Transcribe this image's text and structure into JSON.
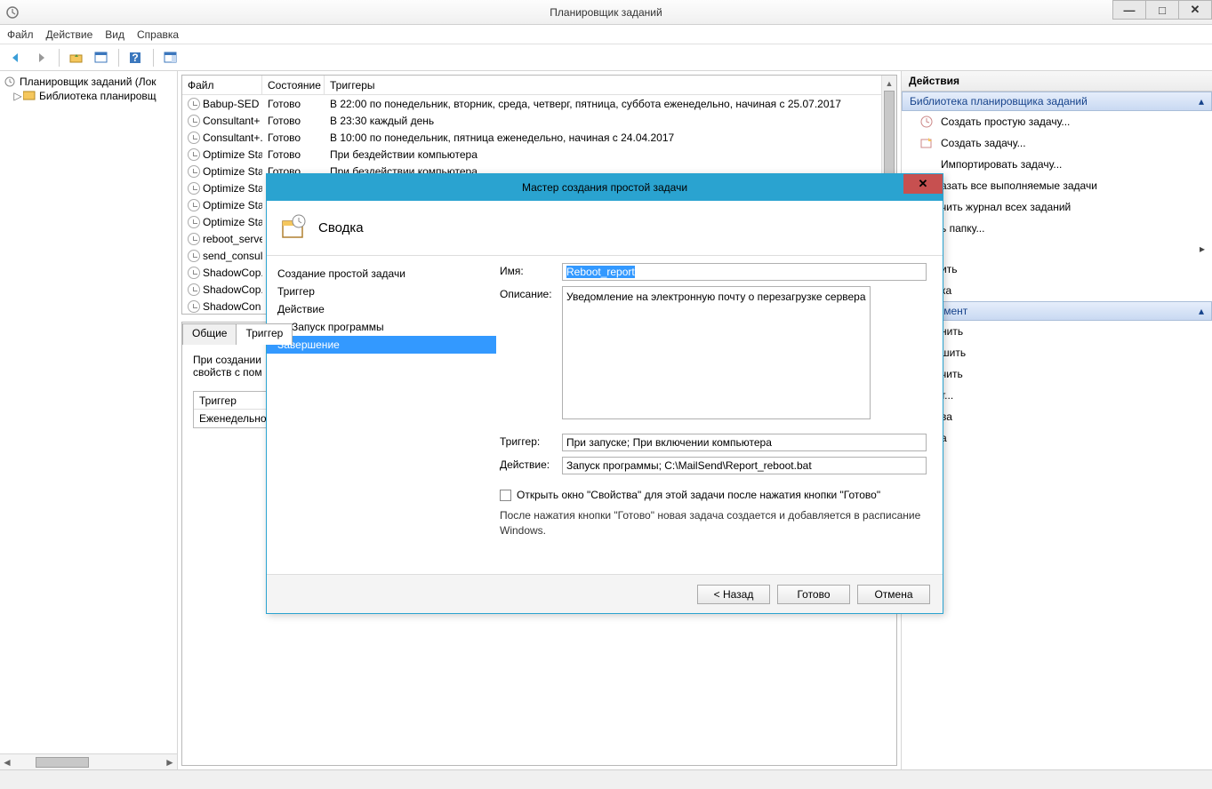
{
  "window": {
    "title": "Планировщик заданий",
    "min": "—",
    "max": "□",
    "close": "✕"
  },
  "menus": {
    "file": "Файл",
    "action": "Действие",
    "view": "Вид",
    "help": "Справка"
  },
  "tree": {
    "root": "Планировщик заданий (Лок",
    "library": "Библиотека планировщ"
  },
  "columns": {
    "file": "Файл",
    "state": "Состояние",
    "trigger": "Триггеры"
  },
  "tasks": [
    {
      "name": "Babup-SED",
      "state": "Готово",
      "trigger": "В 22:00 по понедельник, вторник, среда, четверг, пятница, суббота еженедельно, начиная с 25.07.2017"
    },
    {
      "name": "Consultant+",
      "state": "Готово",
      "trigger": "В 23:30 каждый день"
    },
    {
      "name": "Consultant+...",
      "state": "Готово",
      "trigger": "В 10:00 по понедельник, пятница еженедельно, начиная с 24.04.2017"
    },
    {
      "name": "Optimize Sta...",
      "state": "Готово",
      "trigger": "При бездействии компьютера"
    },
    {
      "name": "Optimize Sta...",
      "state": "Готово",
      "trigger": "При бездействии компьютера"
    },
    {
      "name": "Optimize Sta...",
      "state": "",
      "trigger": ""
    },
    {
      "name": "Optimize Sta...",
      "state": "",
      "trigger": ""
    },
    {
      "name": "Optimize Sta...",
      "state": "",
      "trigger": ""
    },
    {
      "name": "reboot_server",
      "state": "",
      "trigger": ""
    },
    {
      "name": "send_consul...",
      "state": "",
      "trigger": ""
    },
    {
      "name": "ShadowCop...",
      "state": "",
      "trigger": ""
    },
    {
      "name": "ShadowCop...",
      "state": "",
      "trigger": ""
    },
    {
      "name": "ShadowCon",
      "state": "",
      "trigger": ""
    }
  ],
  "detail": {
    "tab_general": "Общие",
    "tab_triggers": "Триггер",
    "hint1": "При создании",
    "hint2": "свойств с пом",
    "th_trigger": "Триггер",
    "td_trigger": "Еженедельно"
  },
  "actions": {
    "header": "Действия",
    "section1": "Библиотека планировщика заданий",
    "items1": [
      "Создать простую задачу...",
      "Создать задачу...",
      "Импортировать задачу...",
      "азать все выполняемые задачи",
      "чить журнал всех заданий",
      "ь папку..."
    ],
    "items1b": [
      "ить",
      "ка"
    ],
    "section2": "ый элемент",
    "items2": [
      "нить",
      "шить",
      "чить",
      "т...",
      "ва",
      "а"
    ]
  },
  "wizard": {
    "title": "Мастер создания простой задачи",
    "banner": "Сводка",
    "nav": {
      "n1": "Создание простой задачи",
      "n2": "Триггер",
      "n3": "Действие",
      "n4": "Запуск программы",
      "n5": "Завершение"
    },
    "form": {
      "name_label": "Имя:",
      "name_value": "Reboot_report",
      "desc_label": "Описание:",
      "desc_value": "Уведомление на электронную почту о перезагрузке сервера",
      "trigger_label": "Триггер:",
      "trigger_value": "При запуске; При включении компьютера",
      "action_label": "Действие:",
      "action_value": "Запуск программы; C:\\MailSend\\Report_reboot.bat",
      "checkbox": "Открыть окно \"Свойства\" для этой задачи после нажатия кнопки \"Готово\"",
      "hint": "После нажатия кнопки \"Готово\" новая задача создается и добавляется в расписание Windows."
    },
    "buttons": {
      "back": "< Назад",
      "finish": "Готово",
      "cancel": "Отмена"
    }
  }
}
